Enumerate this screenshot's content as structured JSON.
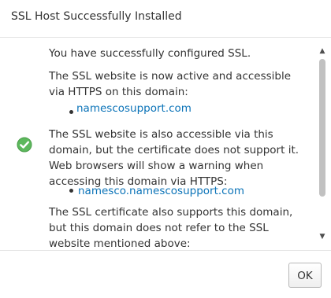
{
  "dialog": {
    "title": "SSL Host Successfully Installed"
  },
  "body": {
    "intro": "You have successfully configured SSL.",
    "active_text": "The SSL website is now active and accessible via HTTPS on this domain:",
    "primary_domain": "namescosupport.com",
    "also_text": "The SSL website is also accessible via this domain, but the certificate does not support it. Web browsers will show a warning when accessing this domain via HTTPS:",
    "secondary_domain": "namesco.namescosupport.com",
    "supports_text": "The SSL certificate also supports this domain, but this domain does not refer to the SSL website mentioned above:",
    "status_icon": "check-circle-icon",
    "status_color": "#5cb85c",
    "link_color": "#0b73b8"
  },
  "footer": {
    "ok_label": "OK"
  }
}
